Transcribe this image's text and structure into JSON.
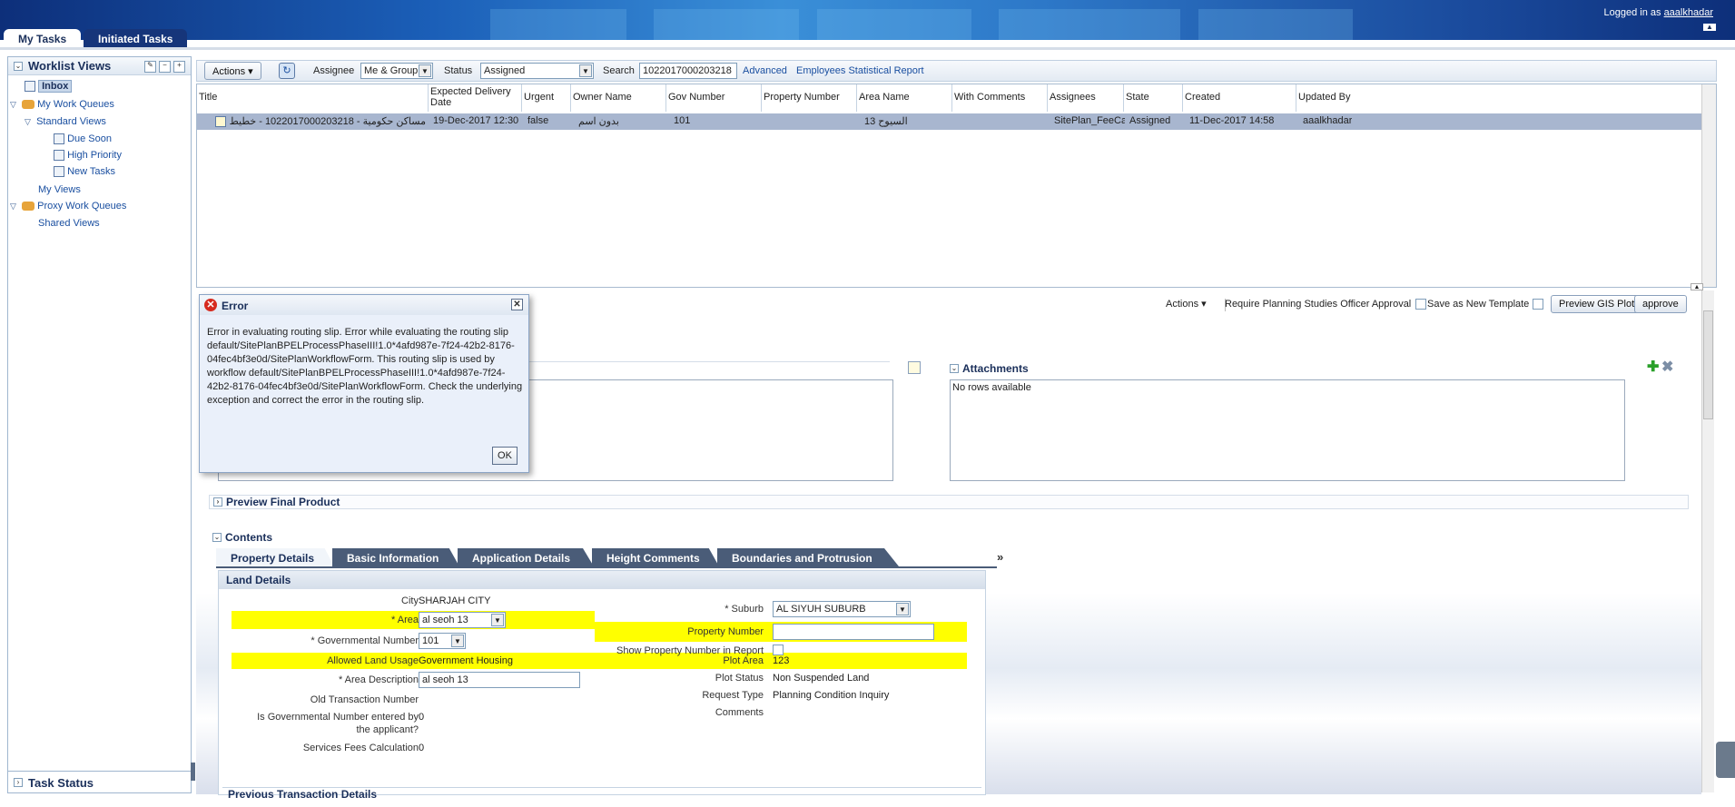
{
  "header": {
    "logged_in_prefix": "Logged in as",
    "user": "aaalkhadar"
  },
  "top_tabs": [
    {
      "label": "My Tasks"
    },
    {
      "label": "Initiated Tasks"
    }
  ],
  "left_panel": {
    "title": "Worklist Views",
    "items": [
      {
        "label": "Inbox"
      },
      {
        "label": "My Work Queues"
      },
      {
        "label": "Standard Views"
      },
      {
        "label": "Due Soon"
      },
      {
        "label": "High Priority"
      },
      {
        "label": "New Tasks"
      },
      {
        "label": "My Views"
      },
      {
        "label": "Proxy Work Queues"
      },
      {
        "label": "Shared Views"
      }
    ],
    "task_status": "Task Status"
  },
  "toolbar": {
    "actions": "Actions",
    "assignee_label": "Assignee",
    "assignee_value": "Me & Group",
    "status_label": "Status",
    "status_value": "Assigned",
    "search_label": "Search",
    "search_value": "1022017000203218",
    "advanced": "Advanced",
    "report": "Employees Statistical Report"
  },
  "grid": {
    "columns": [
      "Title",
      "Expected Delivery Date",
      "Urgent",
      "Owner Name",
      "Gov Number",
      "Property Number",
      "Area Name",
      "With Comments",
      "Assignees",
      "State",
      "Created",
      "Updated By"
    ],
    "row": {
      "title": "مساكن حكومية - 1022017000203218 - خطيط",
      "expected": "19-Dec-2017 12:30",
      "urgent": "false",
      "owner": "بدون اسم",
      "gov": "101",
      "property": "",
      "area": "السيوح 13",
      "comments": "",
      "assignees": "SitePlan_FeeCalc",
      "state": "Assigned",
      "created": "11-Dec-2017 14:58",
      "updated_by": "aaalkhadar"
    }
  },
  "detail": {
    "actions": "Actions",
    "require_approval": "Require Planning Studies Officer Approval",
    "save_template": "Save as New Template",
    "preview_gis": "Preview GIS Plot",
    "approve": "approve",
    "attachments_title": "Attachments",
    "no_rows": "No rows available",
    "preview_final": "Preview Final Product",
    "contents": "Contents",
    "tabs": [
      "Property Details",
      "Basic Information",
      "Application Details",
      "Height Comments",
      "Boundaries and Protrusion"
    ],
    "land_details": "Land Details",
    "previous_transaction": "Previous Transaction Details",
    "fields": {
      "city_label": "City",
      "city_value": "SHARJAH CITY",
      "area_label": "* Area",
      "area_value": "al seoh 13",
      "gov_number_label": "* Governmental Number",
      "gov_number_value": "101",
      "land_usage_label": "Allowed Land Usage",
      "land_usage_value": "Government Housing",
      "area_desc_label": "* Area Description",
      "area_desc_value": "al seoh 13",
      "old_txn_label": "Old Transaction Number",
      "old_txn_value": "",
      "is_gov_label_1": "Is Governmental Number entered by",
      "is_gov_label_2": "the applicant?",
      "is_gov_value": "0",
      "fees_label": "Services Fees Calculation",
      "fees_value": "0",
      "suburb_label": "* Suburb",
      "suburb_value": "AL SIYUH SUBURB",
      "property_number_label": "Property Number",
      "property_number_value": "",
      "show_property_label": "Show Property Number in Report",
      "plot_area_label": "Plot Area",
      "plot_area_value": "123",
      "plot_status_label": "Plot Status",
      "plot_status_value": "Non Suspended Land",
      "request_type_label": "Request Type",
      "request_type_value": "Planning Condition Inquiry",
      "comments_label": "Comments"
    }
  },
  "dialog": {
    "title": "Error",
    "message": "Error in evaluating routing slip. Error while evaluating the routing slip default/SitePlanBPELProcessPhaseIII!1.0*4afd987e-7f24-42b2-8176-04fec4bf3e0d/SitePlanWorkflowForm. This routing slip is used by workflow default/SitePlanBPELProcessPhaseIII!1.0*4afd987e-7f24-42b2-8176-04fec4bf3e0d/SitePlanWorkflowForm. Check the underlying exception and correct the error in the routing slip.",
    "ok": "OK"
  }
}
